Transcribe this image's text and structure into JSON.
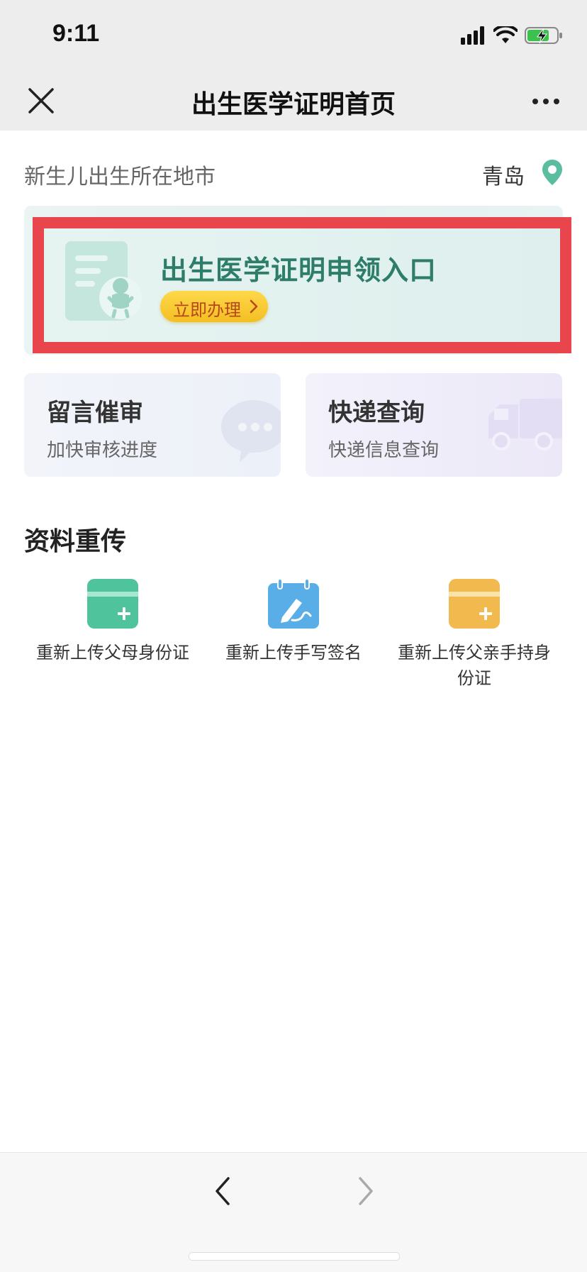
{
  "status": {
    "time": "9:11",
    "icons": [
      "cellular-signal-icon",
      "wifi-icon",
      "battery-charging-icon"
    ]
  },
  "nav": {
    "title": "出生医学证明首页",
    "close_icon": "close-icon",
    "more_icon": "more-icon"
  },
  "city": {
    "label": "新生儿出生所在地市",
    "value": "青岛",
    "pin_color": "#5bbd9f"
  },
  "entry": {
    "title": "出生医学证明申领入口",
    "button_label": "立即办理",
    "highlight_color": "#e8464c"
  },
  "cards": [
    {
      "title": "留言催审",
      "subtitle": "加快审核进度",
      "icon": "chat-bubble-icon"
    },
    {
      "title": "快递查询",
      "subtitle": "快递信息查询",
      "icon": "truck-icon"
    }
  ],
  "reupload": {
    "title": "资料重传",
    "items": [
      {
        "label": "重新上传父母身份证",
        "icon": "id-card-upload-icon",
        "color": "#4fc39b"
      },
      {
        "label": "重新上传手写签名",
        "icon": "signature-upload-icon",
        "color": "#5aaee8"
      },
      {
        "label": "重新上传父亲手持身份证",
        "icon": "id-card-hold-upload-icon",
        "color": "#f2b94e"
      }
    ]
  },
  "bottom_nav": {
    "back_icon": "chevron-left-icon",
    "forward_icon": "chevron-right-icon"
  }
}
